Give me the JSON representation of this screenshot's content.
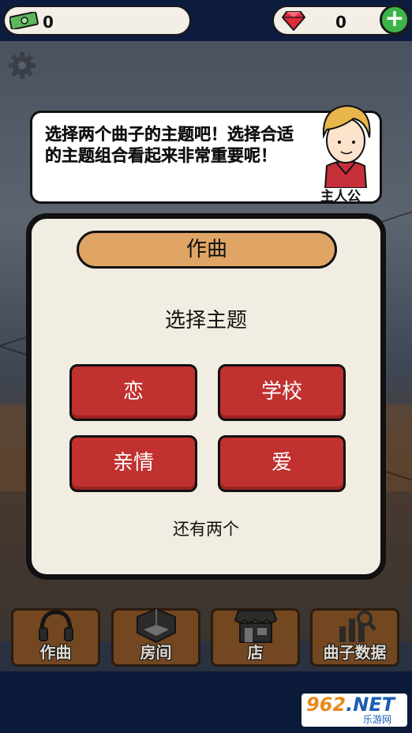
{
  "topbar": {
    "cash_count": "0",
    "gem_count": "0",
    "add_label": "+"
  },
  "bubble": {
    "text": "选择两个曲子的主题吧！选择合适的主题组合看起来非常重要呢！",
    "speaker": "主人公"
  },
  "dialog": {
    "title": "作曲",
    "subtitle": "选择主题",
    "themes": [
      "恋",
      "学校",
      "亲情",
      "爱"
    ],
    "remaining": "还有两个"
  },
  "nav": {
    "items": [
      {
        "label": "作曲",
        "icon": "headphones-icon"
      },
      {
        "label": "房间",
        "icon": "room-icon"
      },
      {
        "label": "店",
        "icon": "store-icon"
      },
      {
        "label": "曲子数据",
        "icon": "chart-search-icon"
      }
    ]
  },
  "watermark": {
    "brand_num": "962",
    "brand_net": ".NET",
    "brand_sub": "乐游网"
  },
  "colors": {
    "topbar": "#0d1b3e",
    "theme_button": "#c0312f",
    "title_pill": "#e0a565",
    "dialog_bg": "#f2ede2",
    "add_button": "#3bb54a"
  }
}
